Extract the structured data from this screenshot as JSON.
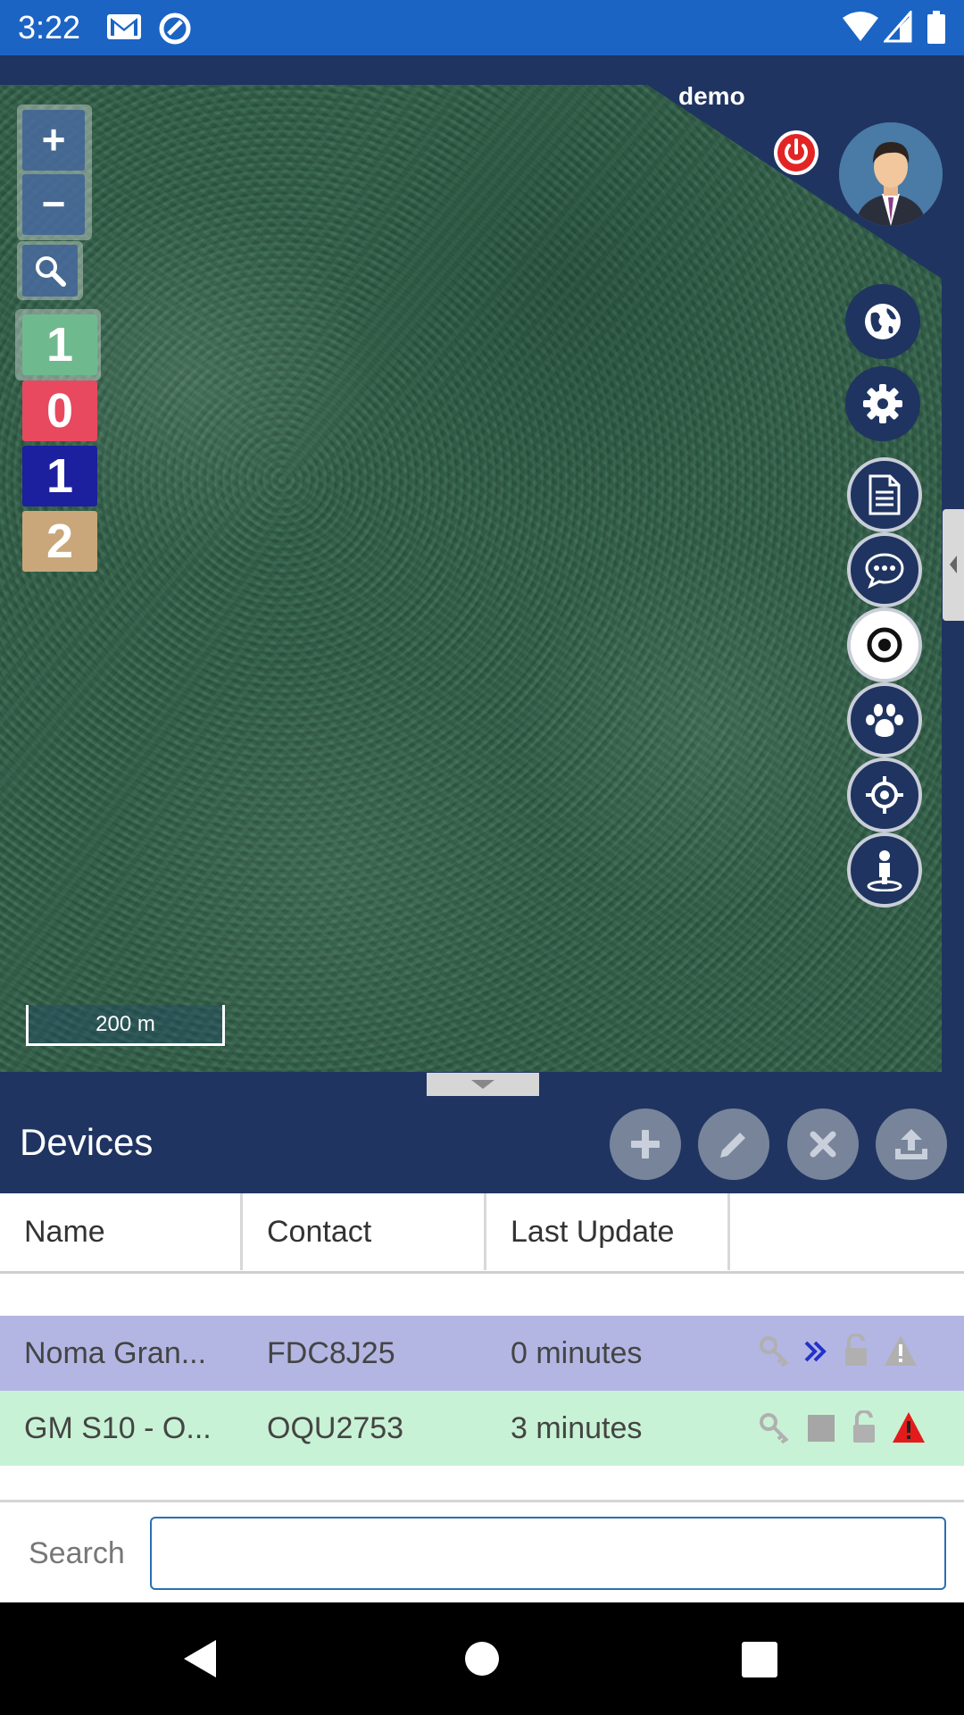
{
  "status_bar": {
    "time": "3:22"
  },
  "user": {
    "name": "demo"
  },
  "map": {
    "zoom_in_label": "+",
    "zoom_out_label": "−",
    "scale_label": "200 m",
    "counters": [
      {
        "value": "1",
        "color": "#6fb98f"
      },
      {
        "value": "0",
        "color": "#e8495f"
      },
      {
        "value": "1",
        "color": "#1c1f9e"
      },
      {
        "value": "2",
        "color": "#c9a77a"
      }
    ]
  },
  "devices": {
    "title": "Devices",
    "columns": [
      "Name",
      "Contact",
      "Last Update"
    ],
    "rows": [
      {
        "name": "Noma Gran...",
        "contact": "FDC8J25",
        "last_update": "0 minutes",
        "bg": "#b3b6e3"
      },
      {
        "name": "GM S10 - O...",
        "contact": "OQU2753",
        "last_update": "3 minutes",
        "bg": "#c8f2d5"
      }
    ]
  },
  "search": {
    "label": "Search",
    "value": ""
  }
}
